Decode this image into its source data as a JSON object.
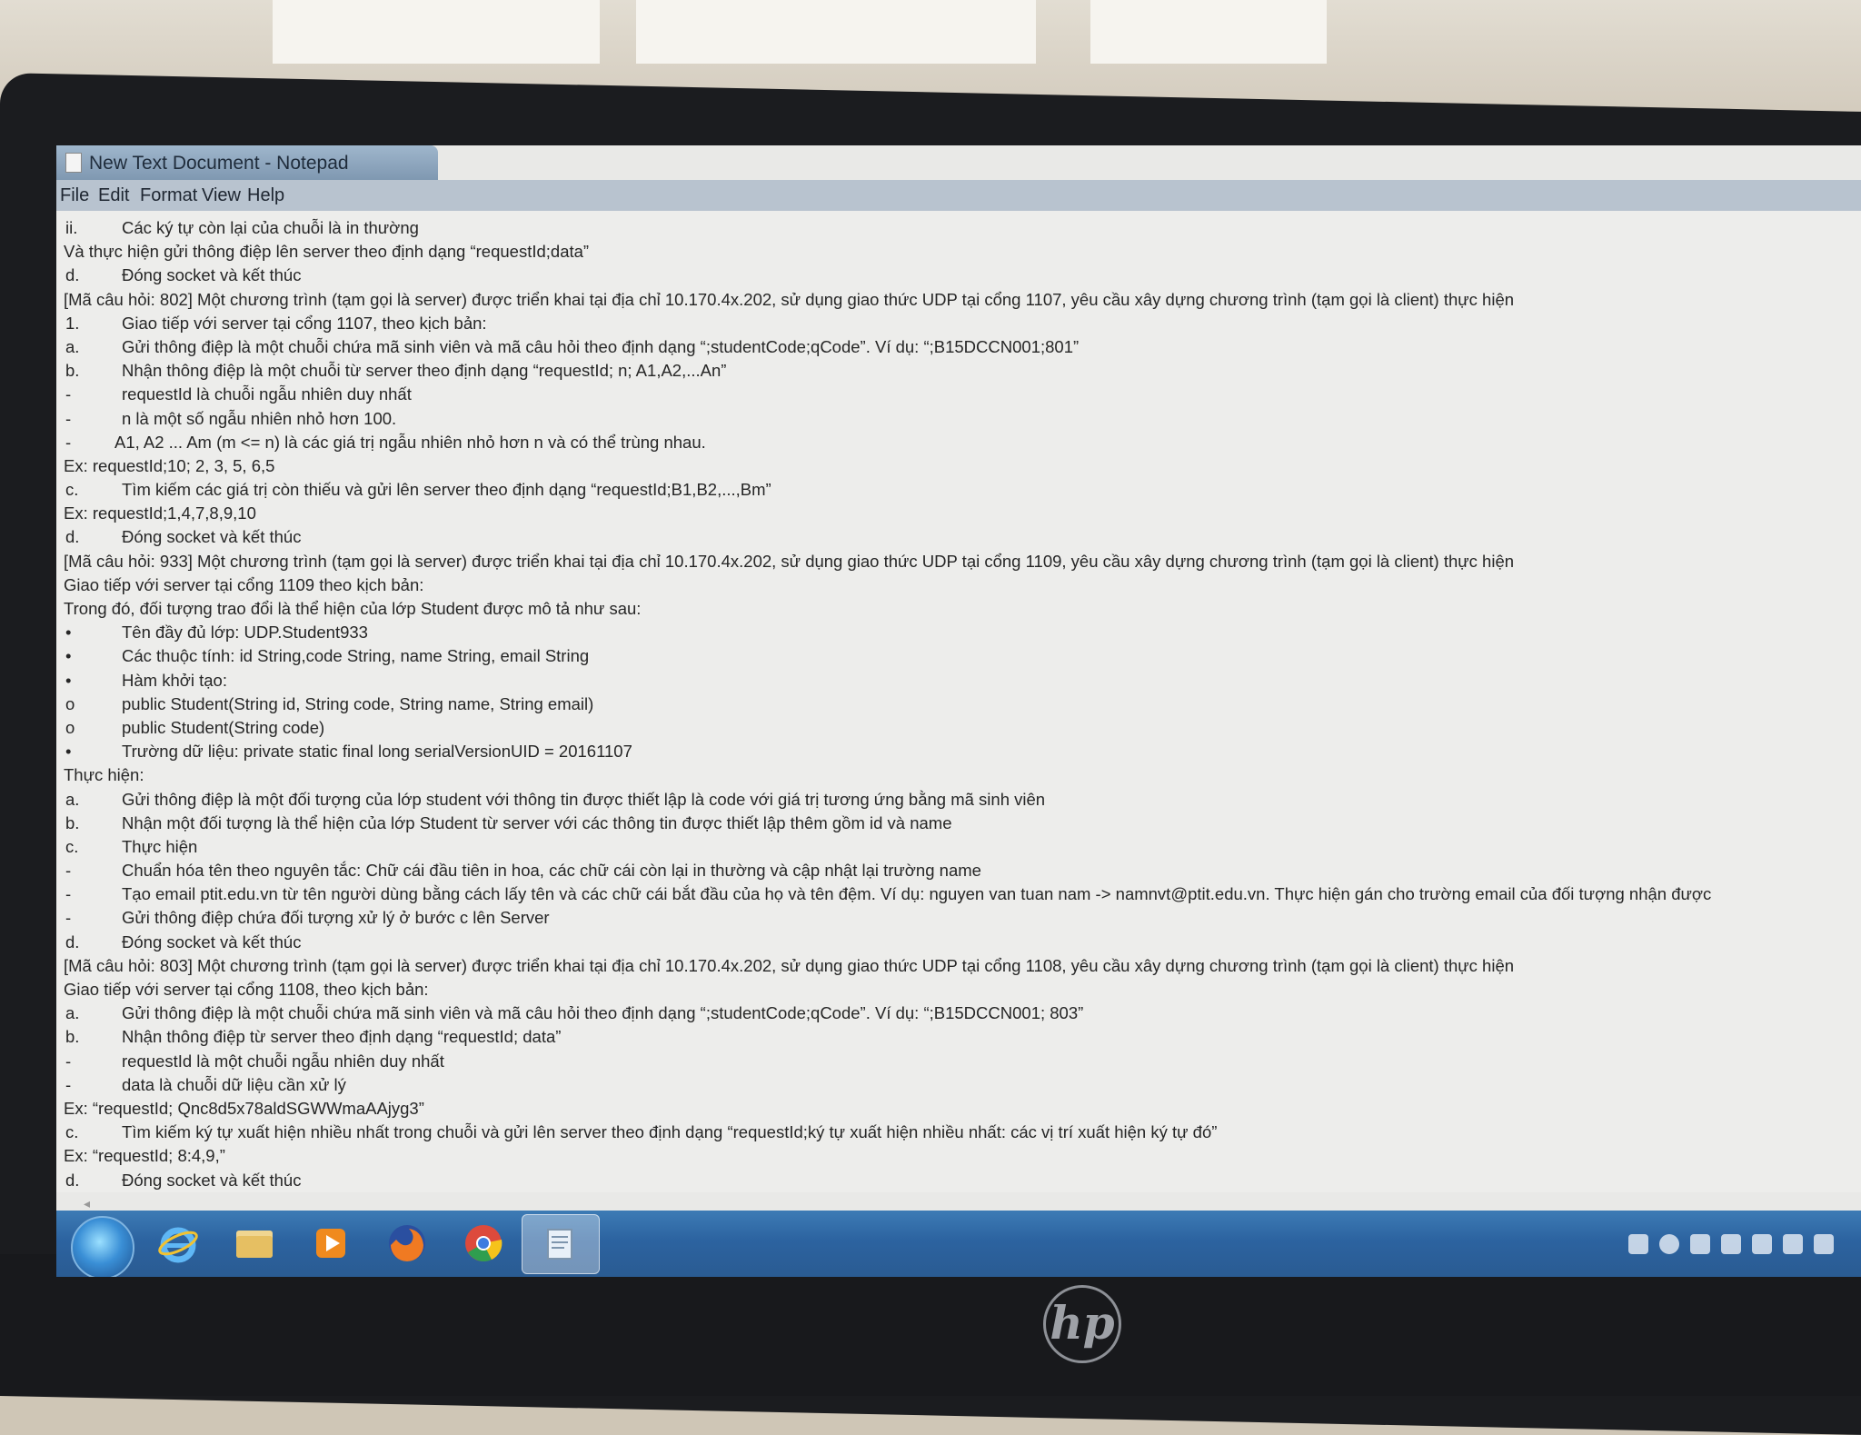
{
  "window": {
    "title": "New Text Document - Notepad"
  },
  "menu": {
    "items": [
      "File",
      "Edit",
      "Format",
      "View",
      "Help"
    ]
  },
  "document": {
    "lines": [
      {
        "marker": "ii.",
        "text": "Các ký tự còn lại của chuỗi là in thường",
        "indent": 1
      },
      {
        "marker": "",
        "text": "Và thực hiện gửi thông điệp lên server theo định dạng “requestId;data”",
        "indent": 0
      },
      {
        "marker": "d.",
        "text": "Đóng socket và kết thúc",
        "indent": 1
      },
      {
        "marker": "",
        "text": "[Mã câu hỏi: 802] Một chương trình (tạm gọi là server) được triển khai tại địa chỉ 10.170.4x.202, sử dụng giao thức UDP tại cổng 1107, yêu cầu xây dựng chương trình (tạm gọi là client) thực hiện",
        "indent": 0
      },
      {
        "marker": "1.",
        "text": "Giao tiếp với server tại cổng 1107, theo kịch bản:",
        "indent": 1
      },
      {
        "marker": "a.",
        "text": "Gửi thông điệp là một chuỗi chứa mã sinh viên và mã câu hỏi theo định dạng “;studentCode;qCode”. Ví dụ: “;B15DCCN001;801”",
        "indent": 1
      },
      {
        "marker": "b.",
        "text": "Nhận thông điệp là một chuỗi từ server theo định dạng “requestId; n; A1,A2,...An”",
        "indent": 1
      },
      {
        "marker": "-",
        "text": "requestId là chuỗi ngẫu nhiên duy nhất",
        "indent": 1
      },
      {
        "marker": "-",
        "text": "n là một số ngẫu nhiên nhỏ hơn 100.",
        "indent": 1
      },
      {
        "marker": "-",
        "text": "A1, A2 ... Am (m <= n) là các giá trị ngẫu nhiên nhỏ hơn n và có thể trùng nhau.",
        "indent": 2
      },
      {
        "marker": "",
        "text": "Ex: requestId;10; 2, 3, 5, 6,5",
        "indent": 0
      },
      {
        "marker": "c.",
        "text": "Tìm kiếm các giá trị còn thiếu và gửi lên server theo định dạng “requestId;B1,B2,...,Bm”",
        "indent": 1
      },
      {
        "marker": "",
        "text": "Ex: requestId;1,4,7,8,9,10",
        "indent": 0
      },
      {
        "marker": "d.",
        "text": "Đóng socket và kết thúc",
        "indent": 1
      },
      {
        "marker": "",
        "text": "[Mã câu hỏi: 933] Một chương trình (tạm gọi là server) được triển khai tại địa chỉ 10.170.4x.202, sử dụng giao thức UDP tại cổng 1109, yêu cầu xây dựng chương trình (tạm gọi là client) thực hiện",
        "indent": 0
      },
      {
        "marker": "",
        "text": "Giao tiếp với server tại cổng 1109 theo kịch bản:",
        "indent": 0
      },
      {
        "marker": "",
        "text": "Trong đó, đối tượng trao đổi là thể hiện của lớp Student được mô tả như sau:",
        "indent": 0
      },
      {
        "marker": "•",
        "text": "Tên đầy đủ lớp: UDP.Student933",
        "indent": 1
      },
      {
        "marker": "•",
        "text": "Các thuộc tính: id String,code String, name String, email String",
        "indent": 1
      },
      {
        "marker": "•",
        "text": "Hàm khởi tạo:",
        "indent": 1
      },
      {
        "marker": "o",
        "text": "public Student(String id, String code, String name, String email)",
        "indent": 1
      },
      {
        "marker": "o",
        "text": "public Student(String code)",
        "indent": 1
      },
      {
        "marker": "•",
        "text": "Trường dữ liệu: private static final long serialVersionUID = 20161107",
        "indent": 1
      },
      {
        "marker": "",
        "text": "Thực hiện:",
        "indent": 0
      },
      {
        "marker": "a.",
        "text": "Gửi thông điệp là một đối tượng của lớp student với thông tin được thiết lập là code với giá trị tương ứng bằng mã sinh viên",
        "indent": 1
      },
      {
        "marker": "b.",
        "text": "Nhận một đối tượng là thể hiện của lớp Student từ server với các thông tin được thiết lập thêm gồm id và name",
        "indent": 1
      },
      {
        "marker": "c.",
        "text": "Thực hiện",
        "indent": 1
      },
      {
        "marker": "-",
        "text": "Chuẩn hóa tên theo nguyên tắc: Chữ cái đầu tiên in hoa, các chữ cái còn lại in thường và cập nhật lại trường name",
        "indent": 1
      },
      {
        "marker": "-",
        "text": "Tạo email ptit.edu.vn từ tên người dùng bằng cách lấy tên và các chữ cái bắt đầu của họ và tên đệm. Ví dụ: nguyen van tuan nam -> namnvt@ptit.edu.vn. Thực hiện gán cho trường email của đối tượng nhận được",
        "indent": 1
      },
      {
        "marker": "-",
        "text": "Gửi thông điệp chứa đối tượng xử lý ở bước c lên Server",
        "indent": 1
      },
      {
        "marker": "d.",
        "text": "Đóng socket và kết thúc",
        "indent": 1
      },
      {
        "marker": "",
        "text": "[Mã câu hỏi: 803] Một chương trình (tạm gọi là server) được triển khai tại địa chỉ 10.170.4x.202, sử dụng giao thức UDP tại cổng 1108, yêu cầu xây dựng chương trình (tạm gọi là client) thực hiện",
        "indent": 0
      },
      {
        "marker": "",
        "text": "Giao tiếp với server tại cổng 1108, theo kịch bản:",
        "indent": 0
      },
      {
        "marker": "a.",
        "text": "Gửi thông điệp là một chuỗi chứa mã sinh viên và mã câu hỏi theo định dạng “;studentCode;qCode”. Ví dụ: “;B15DCCN001; 803”",
        "indent": 1
      },
      {
        "marker": "b.",
        "text": "Nhận thông điệp từ server theo định dạng “requestId; data”",
        "indent": 1
      },
      {
        "marker": "-",
        "text": "requestId là một chuỗi ngẫu nhiên duy nhất",
        "indent": 1
      },
      {
        "marker": "-",
        "text": "data là chuỗi dữ liệu cần xử lý",
        "indent": 1
      },
      {
        "marker": "",
        "text": "Ex: “requestId; Qnc8d5x78aldSGWWmaAAjyg3”",
        "indent": 0
      },
      {
        "marker": "c.",
        "text": "Tìm kiếm ký tự xuất hiện nhiều nhất trong chuỗi và gửi lên server theo định dạng “requestId;ký tự xuất hiện nhiều nhất: các vị trí xuất hiện ký tự đó”",
        "indent": 1
      },
      {
        "marker": "",
        "text": "Ex: “requestId; 8:4,9,”",
        "indent": 0
      },
      {
        "marker": "d.",
        "text": "Đóng socket và kết thúc",
        "indent": 1
      }
    ]
  },
  "taskbar": {
    "icons": [
      "start-orb",
      "internet-explorer-icon",
      "file-explorer-icon",
      "media-player-icon",
      "firefox-icon",
      "chrome-icon",
      "notepad-icon"
    ],
    "active": "notepad-icon"
  },
  "colors": {
    "taskbar": "#2c63a0",
    "editor_bg": "#ededeb",
    "text": "#262626"
  }
}
